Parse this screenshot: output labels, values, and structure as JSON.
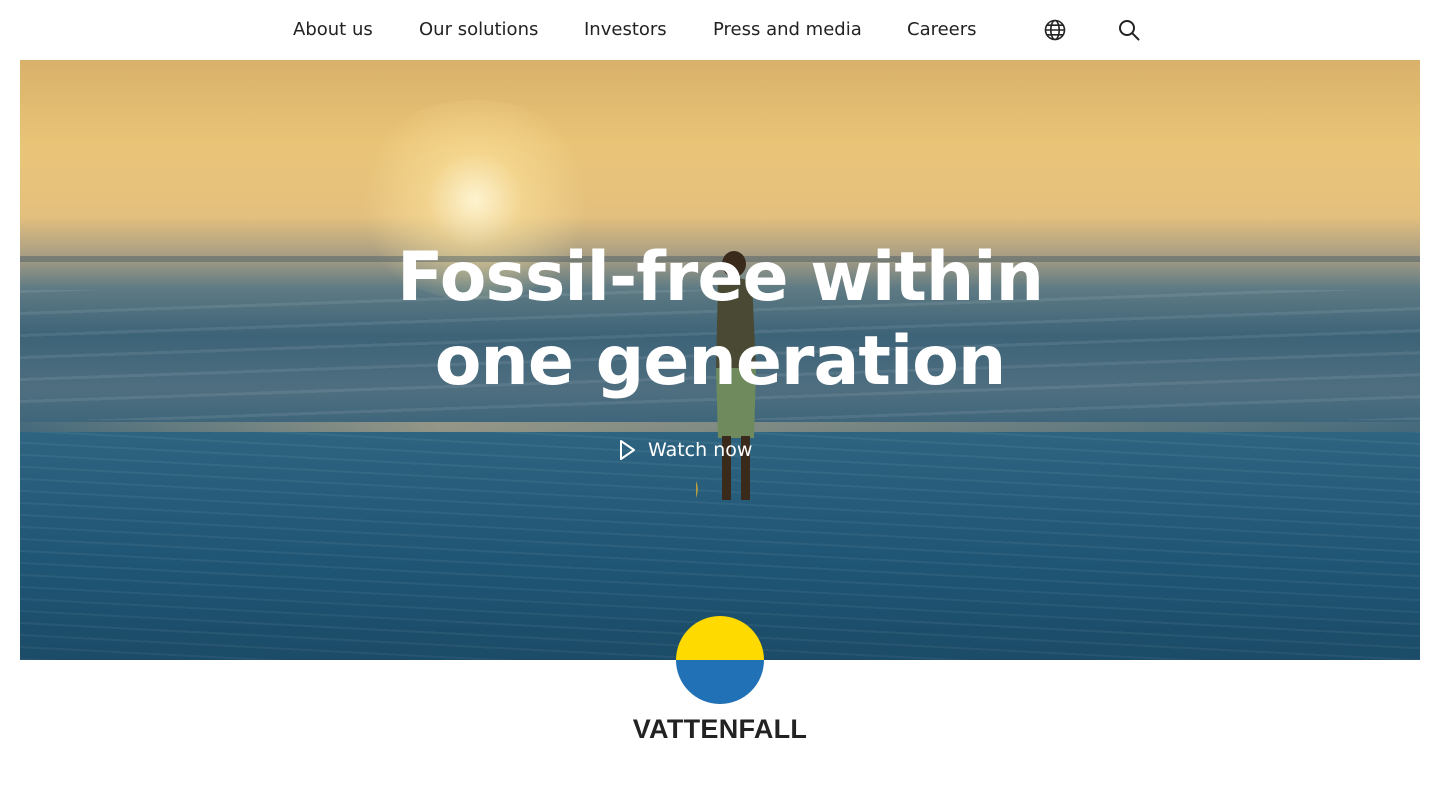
{
  "nav": {
    "items": [
      {
        "label": "About us"
      },
      {
        "label": "Our solutions"
      },
      {
        "label": "Investors"
      },
      {
        "label": "Press and media"
      },
      {
        "label": "Careers"
      }
    ],
    "icons": {
      "language": "globe-icon",
      "search": "search-icon"
    }
  },
  "hero": {
    "title_line1": "Fossil-free within",
    "title_line2": "one generation",
    "cta_label": "Watch now",
    "cta_icon": "play-icon"
  },
  "brand": {
    "name": "VATTENFALL",
    "colors": {
      "yellow": "#ffda00",
      "blue": "#2071b5"
    }
  }
}
